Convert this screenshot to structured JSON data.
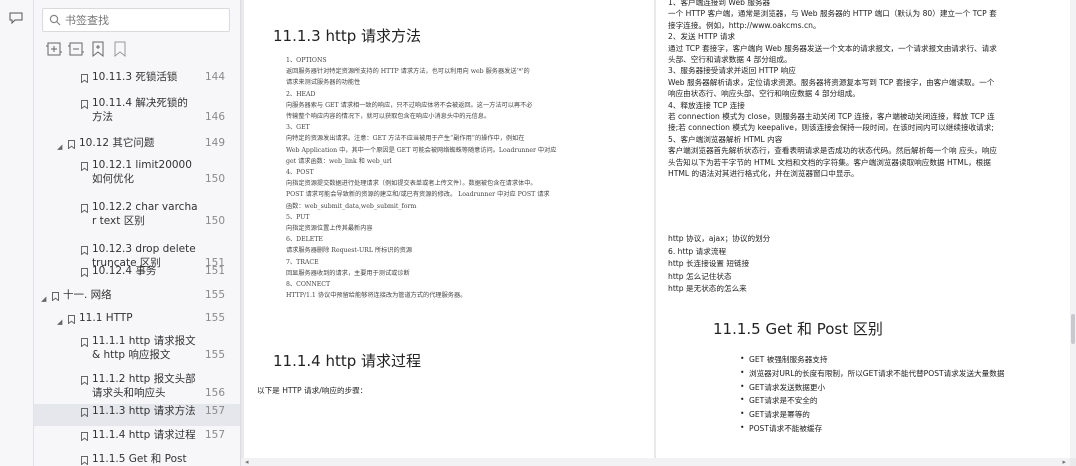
{
  "sidebar": {
    "search_placeholder": "书签查找",
    "items": [
      {
        "label": [
          "10.11.3 死锁活锁"
        ],
        "page": "144"
      },
      {
        "label": [
          "10.11.4 解决死锁的",
          "方法"
        ],
        "page": "146"
      },
      {
        "label": [
          "10.12 其它问题"
        ],
        "page": "149"
      },
      {
        "label": [
          "10.12.1 limit20000",
          "如何优化"
        ],
        "page": "150"
      },
      {
        "label": [
          "10.12.2 char varcha",
          "r text 区别"
        ],
        "page": "150"
      },
      {
        "label": [
          "10.12.3 drop delete",
          "truncate 区别"
        ],
        "page": "151"
      },
      {
        "label": [
          "10.12.4 事务"
        ],
        "page": "151"
      },
      {
        "label": [
          "十一. 网络"
        ],
        "page": "155"
      },
      {
        "label": [
          "11.1 HTTP"
        ],
        "page": "155"
      },
      {
        "label": [
          "11.1.1 http 请求报文",
          "& http 响应报文"
        ],
        "page": "155"
      },
      {
        "label": [
          "11.1.2 http 报文头部",
          "请求头和响应头"
        ],
        "page": "156"
      },
      {
        "label": [
          "11.1.3 http 请求方法"
        ],
        "page": "157"
      },
      {
        "label": [
          "11.1.4 http 请求过程"
        ],
        "page": "157"
      },
      {
        "label": [
          "11.1.5 Get 和 Post"
        ],
        "page": ""
      }
    ]
  },
  "page1": {
    "heading": "11.1.3 http 请求方法",
    "methods": [
      "1、OPTIONS",
      "返回服务器针对特定资源所支持的 HTTP 请求方法，也可以利用向 web 服务器发送‘*’的",
      "请求来测试服务器的功能性",
      "2、HEAD",
      "向服务器索与 GET 请求相一致的响应，只不过响应体将不会被返回。这一方法可以再不必",
      "传输整个响应内容的情况下，就可以获取包含在响应小消息头中的元信息。",
      "3、GET",
      "向特定的资源发出请求。注意：GET 方法不应当被用于产生“副作用”的操作中，例如在",
      "Web Application 中，其中一个原因是 GET 可能会被网络蜘蛛等随意访问。Loadrunner 中对应",
      "get 请求函数：web_link 和 web_url",
      "4、POST",
      "向指定资源提交数据进行处理请求（例如提交表单或者上传文件）。数据被包含在请求体中。",
      "POST 请求可能会导致新的资源的建立和/或已有资源的修改。 Loadrunner 中对应 POST 请求",
      "函数：web_submit_data,web_submit_form",
      "5、PUT",
      "向指定资源位置上传其最新内容",
      "6、DELETE",
      "请求服务器删除 Request-URL 所标识的资源",
      "7、TRACE",
      "回显服务器收到的请求，主要用于测试或诊断",
      "8、CONNECT",
      "HTTP/1.1 协议中预留给能够将连接改为管道方式的代理服务器。"
    ],
    "heading2": "11.1.4 http 请求过程",
    "intro": "以下是 HTTP 请求/响应的步骤："
  },
  "page2": {
    "steps": [
      "1、客户端连接到 Web 服务器",
      "一个 HTTP 客户端，通常是浏览器，与 Web 服务器的 HTTP 端口（默认为 80）建立一个 TCP 套",
      "接字连接。例如，http://www.oakcms.cn。",
      "2、发送 HTTP 请求",
      "通过 TCP 套接字，客户端向 Web 服务器发送一个文本的请求报文，一个请求报文由请求行、请求",
      "头部、空行和请求数据 4 部分组成。",
      "3、服务器接受请求并返回 HTTP 响应",
      "Web 服务器解析请求，定位请求资源。服务器将资源复本写到 TCP 套接字，由客户端读取。一个",
      "响应由状态行、响应头部、空行和响应数据 4 部分组成。",
      "4、释放连接 TCP 连接",
      "若 connection 模式为 close，则服务器主动关闭 TCP 连接，客户端被动关闭连接，释放 TCP 连",
      "接;若 connection 模式为 keepalive，则该连接会保持一段时间，在该时间内可以继续接收请求;",
      "5、客户端浏览器解析 HTML 内容",
      "客户端浏览器首先解析状态行，查看表明请求是否成功的状态代码。然后解析每一个响  应头，响应",
      "头告知以下为若干字节的 HTML 文档和文档的字符集。客户端浏览器读取响应数据 HTML，根据",
      "HTML 的语法对其进行格式化，并在浏览器窗口中显示。"
    ],
    "notes": [
      "http 协议，ajax；协议的划分",
      "6. http 请求流程",
      "http 长连接设置 短链接",
      "http 怎么记住状态",
      "http 是无状态的怎么来"
    ],
    "heading": "11.1.5 Get 和 Post 区别",
    "bullets": [
      "GET 被强制服务器支持",
      "浏览器对URL的长度有限制，所以GET请求不能代替POST请求发送大量数据",
      "GET请求发送数据更小",
      "GET请求是不安全的",
      "GET请求是幂等的",
      "POST请求不能被缓存"
    ]
  },
  "colors": {
    "sidebar_bg": "#f7f7f9",
    "selected_bg": "#e6e7ec",
    "doc_bg": "#e9e9ec"
  },
  "icons": [
    "comment-icon",
    "search-icon",
    "expand-all-icon",
    "collapse-all-icon",
    "add-bookmark-icon",
    "bookmark-outline-icon",
    "bookmark-icon",
    "collapse-arrow-icon"
  ]
}
